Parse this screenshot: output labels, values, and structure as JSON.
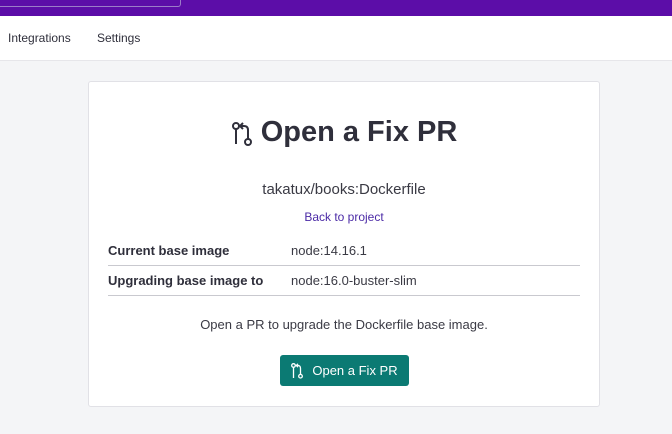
{
  "subnav": {
    "items": [
      {
        "label": "Integrations"
      },
      {
        "label": "Settings"
      }
    ]
  },
  "card": {
    "title": "Open a Fix PR",
    "title_icon": "pull-request-icon",
    "repo": "takatux/books:Dockerfile",
    "back_link": "Back to project",
    "rows": [
      {
        "label": "Current base image",
        "value": "node:14.16.1"
      },
      {
        "label": "Upgrading base image to",
        "value": "node:16.0-buster-slim"
      }
    ],
    "description": "Open a PR to upgrade the Dockerfile base image.",
    "button_label": "Open a Fix PR"
  },
  "colors": {
    "topbar": "#5c0da8",
    "button": "#0b7a73",
    "link": "#4b2aa6"
  }
}
